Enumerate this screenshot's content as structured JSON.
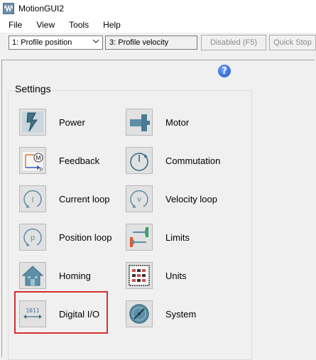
{
  "window": {
    "title": "MotionGUI2"
  },
  "menu": {
    "items": [
      "File",
      "View",
      "Tools",
      "Help"
    ]
  },
  "toolbar": {
    "profile_select": "1: Profile position",
    "profile_secondary": "3: Profile velocity",
    "disabled_label": "Disabled (F5)",
    "quick_stop_label": "Quick Stop"
  },
  "settings": {
    "title": "Settings",
    "left": [
      {
        "label": "Power",
        "icon": "power-icon"
      },
      {
        "label": "Feedback",
        "icon": "feedback-icon"
      },
      {
        "label": "Current loop",
        "icon": "current-loop-icon"
      },
      {
        "label": "Position loop",
        "icon": "position-loop-icon"
      },
      {
        "label": "Homing",
        "icon": "homing-icon"
      },
      {
        "label": "Digital I/O",
        "icon": "digital-io-icon"
      }
    ],
    "right": [
      {
        "label": "Motor",
        "icon": "motor-icon"
      },
      {
        "label": "Commutation",
        "icon": "commutation-icon"
      },
      {
        "label": "Velocity loop",
        "icon": "velocity-loop-icon"
      },
      {
        "label": "Limits",
        "icon": "limits-icon"
      },
      {
        "label": "Units",
        "icon": "units-icon"
      },
      {
        "label": "System",
        "icon": "system-icon"
      }
    ]
  },
  "icon_text": {
    "digital_io": "1011",
    "position_loop": "p",
    "velocity_loop": "v",
    "current_loop": "I",
    "feedback_m": "M",
    "feedback_p": "P"
  },
  "colors": {
    "highlight": "#d32f2f",
    "help": "#1f55c9",
    "icon_blue": "#5d8fa6"
  }
}
